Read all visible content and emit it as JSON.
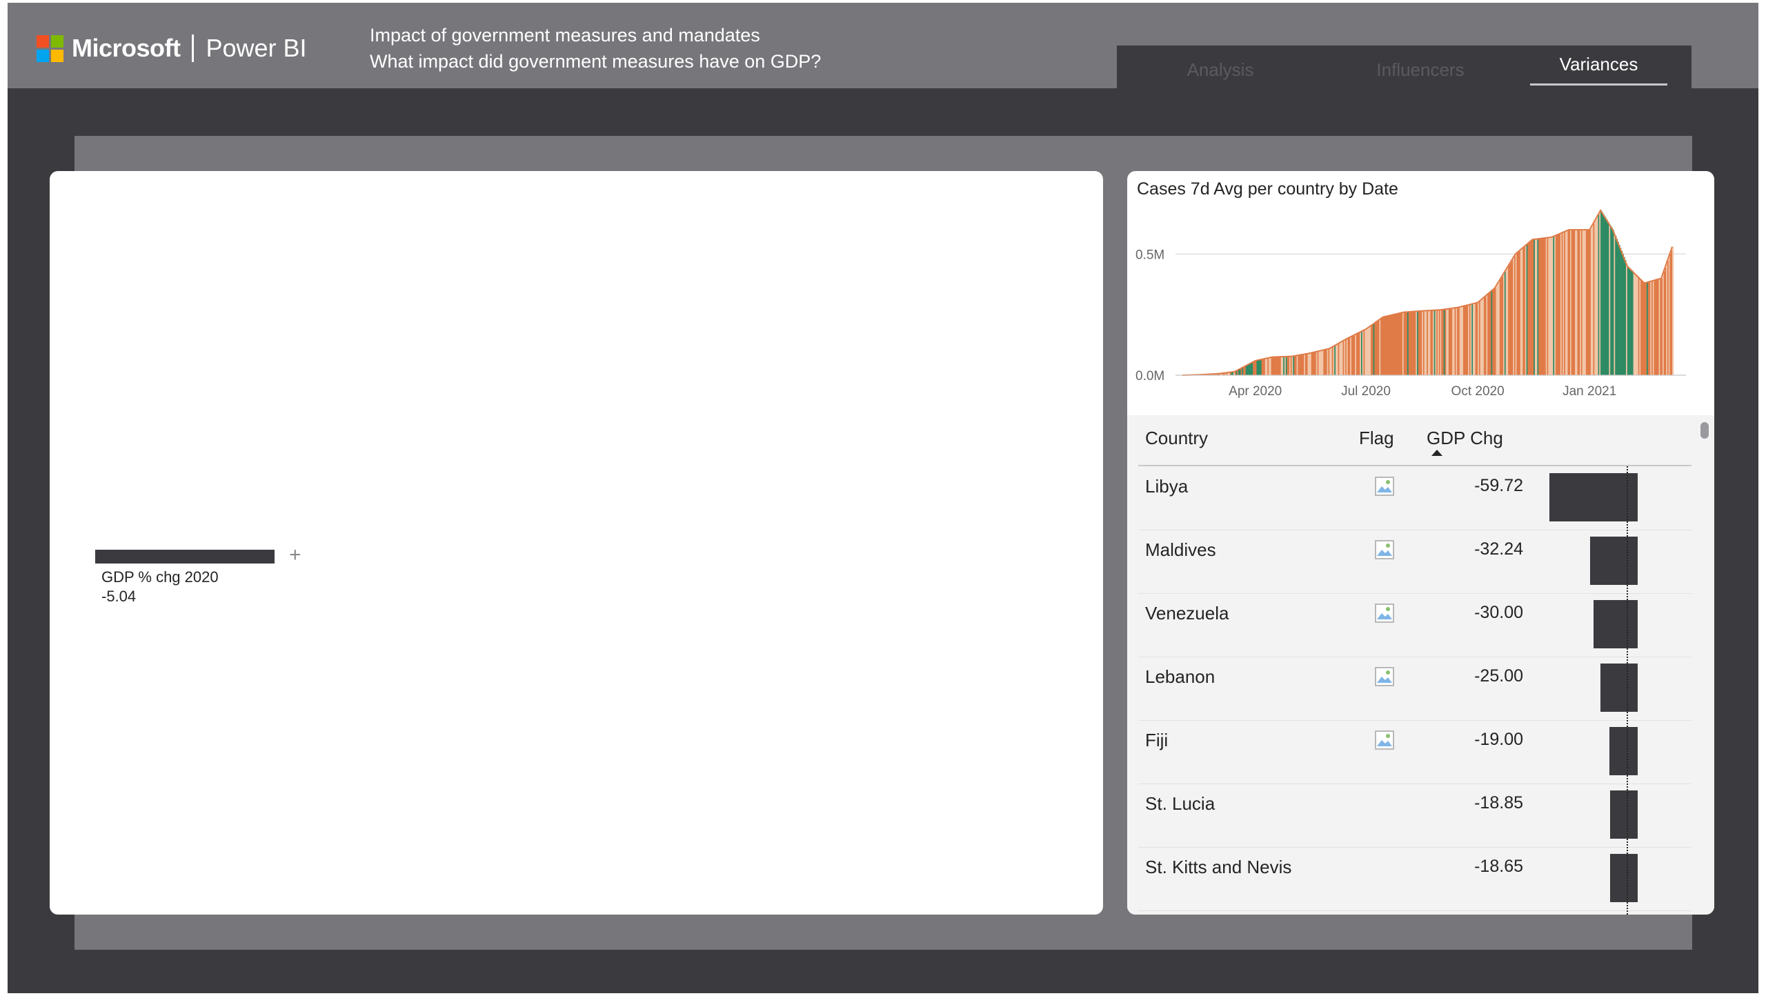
{
  "header": {
    "brand": "Microsoft",
    "product": "Power BI",
    "subtitle_line1": "Impact of government measures and mandates",
    "subtitle_line2": "What impact did government measures have on GDP?"
  },
  "tabs": [
    {
      "label": "Analysis",
      "active": false
    },
    {
      "label": "Influencers",
      "active": false
    },
    {
      "label": "Variances",
      "active": true
    }
  ],
  "left_visual": {
    "label": "GDP % chg 2020",
    "value": "-5.04"
  },
  "chart_data": {
    "type": "area",
    "title": "Cases 7d Avg per country by Date",
    "x_ticks": [
      "Apr 2020",
      "Jul 2020",
      "Oct 2020",
      "Jan 2021"
    ],
    "y_ticks": [
      "0.0M",
      "0.5M"
    ],
    "ylim": [
      0,
      0.7
    ],
    "x": [
      "2020-02-01",
      "2020-02-15",
      "2020-03-01",
      "2020-03-15",
      "2020-04-01",
      "2020-04-15",
      "2020-05-01",
      "2020-05-15",
      "2020-06-01",
      "2020-06-15",
      "2020-07-01",
      "2020-07-15",
      "2020-08-01",
      "2020-08-15",
      "2020-09-01",
      "2020-09-15",
      "2020-10-01",
      "2020-10-15",
      "2020-11-01",
      "2020-11-15",
      "2020-12-01",
      "2020-12-15",
      "2021-01-01",
      "2021-01-10",
      "2021-01-20",
      "2021-02-01",
      "2021-02-15",
      "2021-03-01",
      "2021-03-10"
    ],
    "series": [
      {
        "values": [
          0.0,
          0.002,
          0.006,
          0.015,
          0.06,
          0.075,
          0.078,
          0.09,
          0.11,
          0.15,
          0.19,
          0.24,
          0.26,
          0.265,
          0.27,
          0.28,
          0.3,
          0.36,
          0.5,
          0.56,
          0.57,
          0.6,
          0.6,
          0.68,
          0.6,
          0.45,
          0.38,
          0.4,
          0.53
        ]
      }
    ],
    "colors": {
      "fill_primary": "#e07b48",
      "fill_light": "#f2c6a8",
      "fill_green": "#2e8b63",
      "grid": "#e6e6e6"
    }
  },
  "table": {
    "headers": {
      "country": "Country",
      "flag": "Flag",
      "gdp": "GDP Chg"
    },
    "rows": [
      {
        "country": "Libya",
        "gdp": "-59.72",
        "value": -59.72,
        "flag": true
      },
      {
        "country": "Maldives",
        "gdp": "-32.24",
        "value": -32.24,
        "flag": true
      },
      {
        "country": "Venezuela",
        "gdp": "-30.00",
        "value": -30.0,
        "flag": true
      },
      {
        "country": "Lebanon",
        "gdp": "-25.00",
        "value": -25.0,
        "flag": true
      },
      {
        "country": "Fiji",
        "gdp": "-19.00",
        "value": -19.0,
        "flag": true
      },
      {
        "country": "St. Lucia",
        "gdp": "-18.85",
        "value": -18.85,
        "flag": false
      },
      {
        "country": "St. Kitts and Nevis",
        "gdp": "-18.65",
        "value": -18.65,
        "flag": false
      }
    ]
  },
  "icons": {
    "logo": "microsoft-logo",
    "plus": "plus-icon",
    "flag": "broken-image-icon",
    "sort": "sort-ascending-icon"
  },
  "logo_colors": [
    "#f25022",
    "#7fba00",
    "#00a4ef",
    "#ffb900"
  ]
}
